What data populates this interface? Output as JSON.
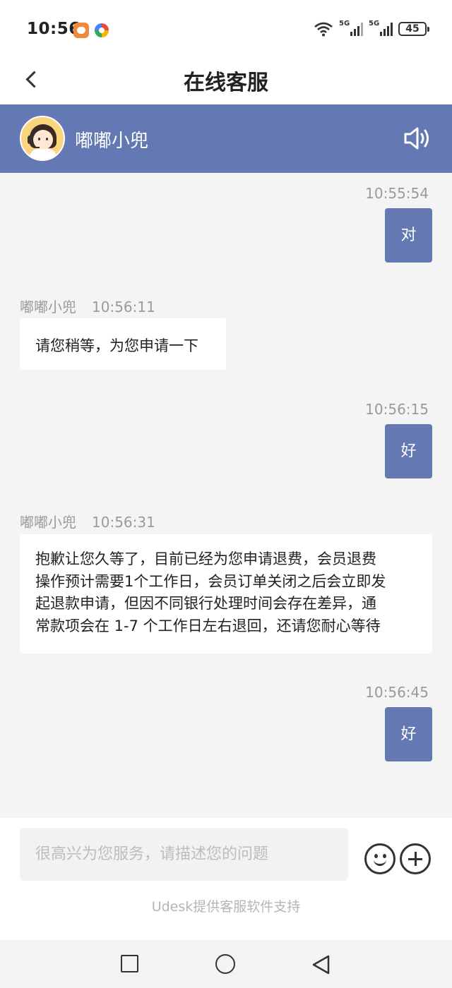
{
  "status_bar": {
    "time": "10:56",
    "network_1": "5G",
    "network_2": "5G",
    "battery": "45"
  },
  "nav": {
    "title": "在线客服"
  },
  "agent": {
    "name": "嘟嘟小兜"
  },
  "messages": [
    {
      "from": "user",
      "time": "10:55:54",
      "text": "对"
    },
    {
      "from": "agent",
      "sender": "嘟嘟小兜",
      "time": "10:56:11",
      "text": "请您稍等，为您申请一下"
    },
    {
      "from": "user",
      "time": "10:56:15",
      "text": "好"
    },
    {
      "from": "agent",
      "sender": "嘟嘟小兜",
      "time": "10:56:31",
      "lines": [
        "抱歉让您久等了，目前已经为您申请退费，会员退费",
        "操作预计需要1个工作日，会员订单关闭之后会立即发",
        "起退款申请，但因不同银行处理时间会存在差异，通",
        "常款项会在 1-7 个工作日左右退回，还请您耐心等待"
      ]
    },
    {
      "from": "user",
      "time": "10:56:45",
      "text": "好"
    }
  ],
  "input": {
    "placeholder": "很高兴为您服务，请描述您的问题",
    "value": ""
  },
  "footer": {
    "powered_by": "Udesk提供客服软件支持"
  },
  "icons": {
    "back": "chevron-left-icon",
    "speaker": "speaker-icon",
    "emoji": "emoji-icon",
    "plus": "plus-icon",
    "nav_recents": "square-icon",
    "nav_home": "circle-icon",
    "nav_back": "triangle-back-icon"
  },
  "colors": {
    "agent_bar": "#6478b3",
    "user_bubble": "#6478b3",
    "chat_background": "#f4f4f4",
    "agent_bubble": "#ffffff"
  }
}
